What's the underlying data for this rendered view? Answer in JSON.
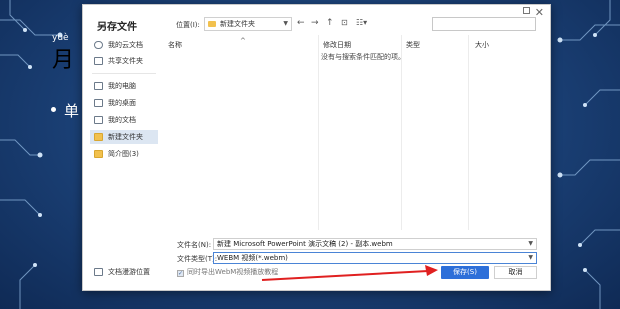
{
  "slide": {
    "pinyin": "yuè",
    "title": "月",
    "bullet": "单"
  },
  "dialog": {
    "title": "另存文件",
    "close_glyph": "✕",
    "location": {
      "label": "位置(I):",
      "value": "新建文件夹"
    },
    "sidebar": {
      "items": [
        {
          "label": "我的云文档",
          "icon": "cloud-icon"
        },
        {
          "label": "共享文件夹",
          "icon": "shared-folder-icon"
        },
        {
          "label": "我的电脑",
          "icon": "computer-icon"
        },
        {
          "label": "我的桌面",
          "icon": "desktop-icon"
        },
        {
          "label": "我的文档",
          "icon": "documents-icon"
        },
        {
          "label": "新建文件夹",
          "icon": "folder-icon"
        },
        {
          "label": "简介图(3)",
          "icon": "folder-icon"
        }
      ],
      "bottom": "文档漫游位置"
    },
    "columns": [
      "名称",
      "修改日期",
      "类型",
      "大小"
    ],
    "empty_message": "没有与搜索条件匹配的项。",
    "filename": {
      "label": "文件名(N):",
      "value": "新建 Microsoft PowerPoint 演示文稿 (2) - 副本.webm"
    },
    "filetype": {
      "label": "文件类型(T):",
      "value": "WEBM 视频(*.webm)"
    },
    "checkbox_label": "同时导出WebM视频播放教程",
    "save_label": "保存(S)",
    "cancel_label": "取消",
    "accent_color": "#2d6fd9",
    "arrow_color": "#e02020"
  }
}
